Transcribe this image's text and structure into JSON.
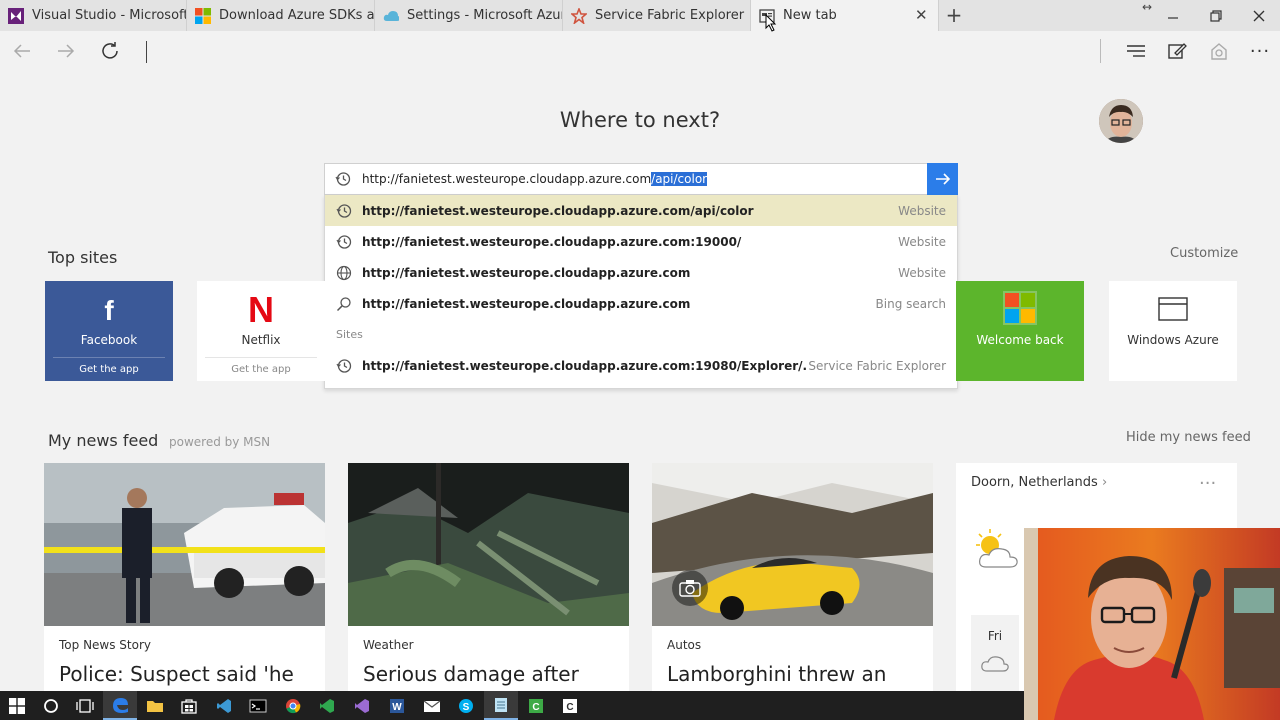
{
  "tabs": [
    {
      "title": "Visual Studio - Microsoft De",
      "icon": "visual-studio-icon"
    },
    {
      "title": "Download Azure SDKs and",
      "icon": "microsoft-logo-icon"
    },
    {
      "title": "Settings - Microsoft Azure",
      "icon": "azure-cloud-icon"
    },
    {
      "title": "Service Fabric Explorer",
      "icon": "service-fabric-icon"
    },
    {
      "title": "New tab",
      "icon": "new-tab-icon",
      "active": true
    }
  ],
  "page": {
    "heading": "Where to next?"
  },
  "address": {
    "url_main": "http://fanietest.westeurope.cloudapp.azure.com",
    "url_selected": "/api/color"
  },
  "suggestions": [
    {
      "text": "http://fanietest.westeurope.cloudapp.azure.com/api/color",
      "type": "Website",
      "icon": "history-icon",
      "highlighted": true
    },
    {
      "text": "http://fanietest.westeurope.cloudapp.azure.com:19000/",
      "type": "Website",
      "icon": "history-icon"
    },
    {
      "text": "http://fanietest.westeurope.cloudapp.azure.com",
      "type": "Website",
      "icon": "globe-icon"
    },
    {
      "text": "http://fanietest.westeurope.cloudapp.azure.com",
      "type": "Bing search",
      "icon": "search-icon"
    }
  ],
  "sites_label": "Sites",
  "site_suggestion": {
    "text": "http://fanietest.westeurope.cloudapp.azure.com:19080/Explorer/...",
    "type": "Service Fabric Explorer",
    "icon": "history-icon"
  },
  "top_sites": {
    "title": "Top sites",
    "customize": "Customize",
    "tiles": [
      {
        "name": "Facebook",
        "sub": "Get the app",
        "bg": "#3b5998"
      },
      {
        "name": "Netflix",
        "sub": "Get the app",
        "bg": "#ffffff"
      },
      {
        "name": "Welcome back",
        "bg": "#5cb52c"
      },
      {
        "name": "Windows Azure",
        "bg": "#ffffff"
      }
    ]
  },
  "news": {
    "title": "My news feed",
    "powered": "powered by MSN",
    "hide": "Hide my news feed",
    "cards": [
      {
        "category": "Top News Story",
        "headline": "Police: Suspect said 'he"
      },
      {
        "category": "Weather",
        "headline": "Serious damage after"
      },
      {
        "category": "Autos",
        "headline": "Lamborghini threw an"
      }
    ]
  },
  "weather": {
    "location": "Doorn, Netherlands",
    "day": "Fri"
  },
  "colors": {
    "accent": "#2b7de9",
    "highlight": "#ece8c4",
    "facebook": "#3b5998",
    "netflix": "#e50914",
    "xbox": "#5cb52c"
  }
}
